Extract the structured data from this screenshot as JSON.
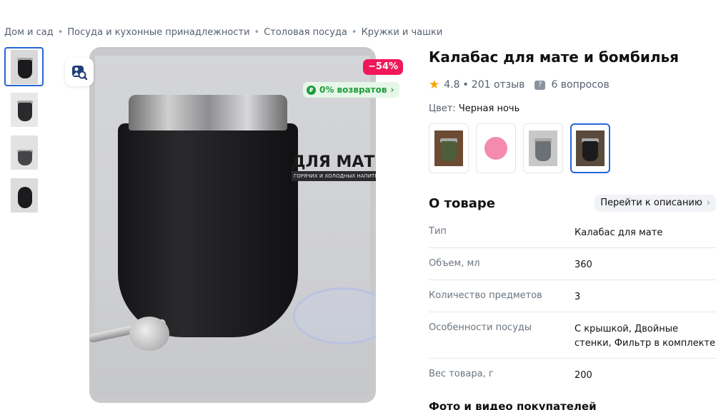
{
  "breadcrumb": [
    "Дом и сад",
    "Посуда и кухонные принадлежности",
    "Столовая посуда",
    "Кружки и чашки"
  ],
  "gallery": {
    "thumbnails": [
      "thumb-1",
      "thumb-2",
      "thumb-3",
      "thumb-4"
    ],
    "active_index": 0,
    "discount": "−54%",
    "returns_label": "0% возвратов",
    "returns_icon": "ruble-return-icon",
    "zoom_icon": "search-image-icon",
    "photo_title": "ДЛЯ МАТЕ",
    "photo_subtitle": "ГОРЯЧИХ И ХОЛОДНЫХ НАПИТКОВ"
  },
  "product": {
    "title": "Калабас для мате и бомбилья",
    "rating": "4.8",
    "reviews": "201 отзыв",
    "questions": "6 вопросов",
    "color_label": "Цвет:",
    "color_value": "Черная ночь",
    "swatches": [
      {
        "name": "olive",
        "color": "#4f5e3a"
      },
      {
        "name": "pink",
        "color": "#f48aae"
      },
      {
        "name": "grey",
        "color": "#6d7076"
      },
      {
        "name": "black",
        "color": "#1b1b1d"
      }
    ],
    "active_swatch": 3
  },
  "about": {
    "title": "О товаре",
    "go_to_description": "Перейти к описанию",
    "specs": [
      {
        "key": "Тип",
        "value": "Калабас для мате"
      },
      {
        "key": "Объем, мл",
        "value": "360"
      },
      {
        "key": "Количество предметов",
        "value": "3"
      },
      {
        "key": "Особенности посуды",
        "value": "С крышкой, Двойные стенки, Фильтр в комплекте"
      },
      {
        "key": "Вес товара, г",
        "value": "200"
      }
    ]
  },
  "photos_section_title": "Фото и видео покупателей",
  "colors": {
    "accent": "#2466d6",
    "discount": "#f0185a",
    "returns": "#1d9e3a",
    "star": "#f7a600"
  }
}
